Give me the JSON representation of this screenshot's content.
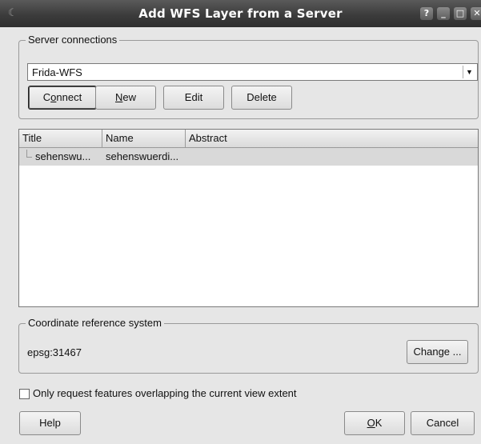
{
  "window": {
    "title": "Add WFS Layer from a Server",
    "controls": {
      "help": "?",
      "minimize": "_",
      "maximize": "□",
      "close": "✕"
    }
  },
  "server_connections": {
    "group_label": "Server connections",
    "selected_connection": "Frida-WFS",
    "buttons": {
      "connect_pre": "C",
      "connect_mnemonic": "o",
      "connect_post": "nnect",
      "new_mnemonic": "N",
      "new_post": "ew",
      "edit": "Edit",
      "delete": "Delete"
    }
  },
  "layers_table": {
    "columns": [
      "Title",
      "Name",
      "Abstract"
    ],
    "rows": [
      {
        "title": "sehenswu...",
        "name": "sehenswuerdi...",
        "abstract": ""
      }
    ]
  },
  "crs": {
    "group_label": "Coordinate reference system",
    "value": "epsg:31467",
    "change_button": "Change ..."
  },
  "extent_option": {
    "label": "Only request features overlapping the current view extent",
    "checked": false
  },
  "footer": {
    "help": "Help",
    "ok_mnemonic": "O",
    "ok_post": "K",
    "cancel": "Cancel"
  }
}
